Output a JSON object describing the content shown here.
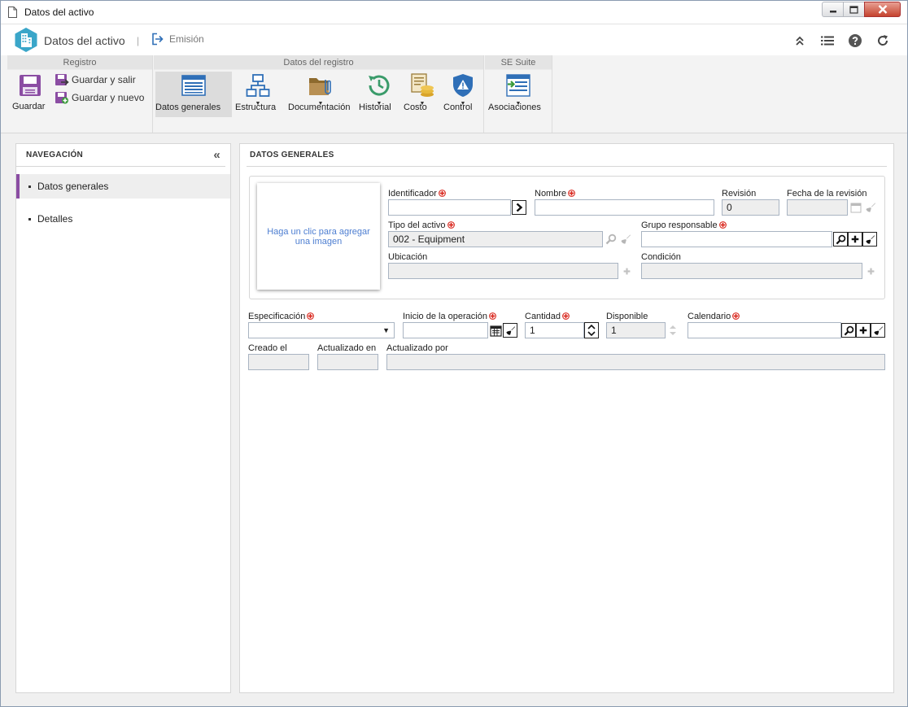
{
  "window": {
    "title": "Datos del activo"
  },
  "header": {
    "app_title": "Datos del activo",
    "separator": "|",
    "emision_label": "Emisión"
  },
  "ribbon": {
    "groups": {
      "registro": "Registro",
      "datos_registro": "Datos del registro",
      "se_suite": "SE Suite"
    },
    "buttons": {
      "guardar": "Guardar",
      "guardar_salir": "Guardar y salir",
      "guardar_nuevo": "Guardar y nuevo",
      "datos_generales": "Datos generales",
      "estructura": "Estructura",
      "documentacion": "Documentación",
      "historial": "Historial",
      "costo": "Costo",
      "control": "Control",
      "asociaciones": "Asociaciones"
    },
    "active_button": "datos_generales"
  },
  "navigation": {
    "title": "NAVEGACIÓN",
    "items": [
      {
        "label": "Datos generales",
        "active": true
      },
      {
        "label": "Detalles",
        "active": false
      }
    ]
  },
  "main": {
    "title": "DATOS GENERALES",
    "image_placeholder": "Haga un clic para agregar una imagen",
    "fields": {
      "identificador": {
        "label": "Identificador",
        "value": ""
      },
      "nombre": {
        "label": "Nombre",
        "value": ""
      },
      "revision": {
        "label": "Revisión",
        "value": "0"
      },
      "fecha_revision": {
        "label": "Fecha de la revisión",
        "value": ""
      },
      "tipo_activo": {
        "label": "Tipo del activo",
        "value": "002 - Equipment"
      },
      "grupo_responsable": {
        "label": "Grupo responsable",
        "value": ""
      },
      "ubicacion": {
        "label": "Ubicación",
        "value": ""
      },
      "condicion": {
        "label": "Condición",
        "value": ""
      },
      "especificacion": {
        "label": "Especificación",
        "value": ""
      },
      "inicio_operacion": {
        "label": "Inicio de la operación",
        "value": ""
      },
      "cantidad": {
        "label": "Cantidad",
        "value": "1"
      },
      "disponible": {
        "label": "Disponible",
        "value": "1"
      },
      "calendario": {
        "label": "Calendario",
        "value": ""
      },
      "creado_el": {
        "label": "Creado el",
        "value": ""
      },
      "actualizado_en": {
        "label": "Actualizado en",
        "value": ""
      },
      "actualizado_por": {
        "label": "Actualizado por",
        "value": ""
      }
    }
  },
  "colors": {
    "accent_purple": "#8b4da3",
    "required_red": "#d9261c",
    "link_blue": "#4d7ed1",
    "logo_teal": "#3aa6c9"
  }
}
